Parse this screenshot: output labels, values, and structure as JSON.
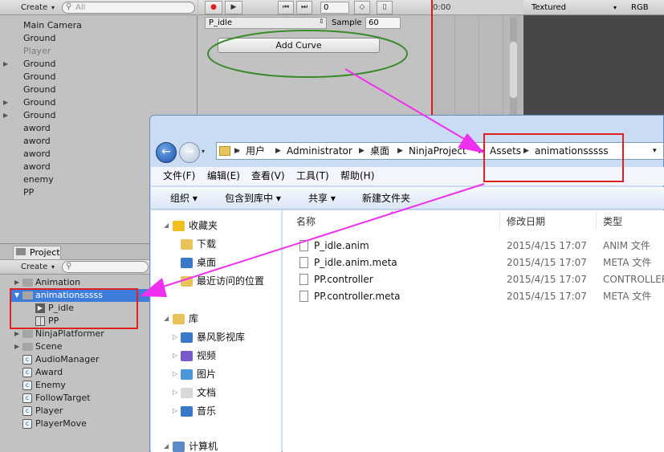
{
  "hierarchy": {
    "create_label": "Create",
    "search_placeholder": "All",
    "items": [
      {
        "label": "Main Camera",
        "expand": false,
        "gray": false
      },
      {
        "label": "Ground",
        "expand": false,
        "gray": false
      },
      {
        "label": "Player",
        "expand": false,
        "gray": true
      },
      {
        "label": "Ground",
        "expand": true,
        "gray": false
      },
      {
        "label": "Ground",
        "expand": false,
        "gray": false
      },
      {
        "label": "Ground",
        "expand": false,
        "gray": false
      },
      {
        "label": "Ground",
        "expand": true,
        "gray": false
      },
      {
        "label": "Ground",
        "expand": true,
        "gray": false
      },
      {
        "label": "aword",
        "expand": false,
        "gray": false
      },
      {
        "label": "aword",
        "expand": false,
        "gray": false
      },
      {
        "label": "aword",
        "expand": false,
        "gray": false
      },
      {
        "label": "aword",
        "expand": false,
        "gray": false
      },
      {
        "label": "enemy",
        "expand": false,
        "gray": false
      },
      {
        "label": "PP",
        "expand": false,
        "gray": false
      }
    ]
  },
  "animation": {
    "frame_value": "0",
    "clip_name": "P_idle",
    "sample_label": "Sample",
    "sample_value": "60",
    "add_curve_label": "Add Curve",
    "time_label": "0:00"
  },
  "game": {
    "shading": "Textured",
    "channel": "RGB"
  },
  "project": {
    "tab_label": "Project",
    "create_label": "Create",
    "items": [
      {
        "label": "Animation",
        "icon": "folder",
        "expand": "closed",
        "indent": 0
      },
      {
        "label": "animationsssss",
        "icon": "folder",
        "expand": "open",
        "indent": 0,
        "selected": true
      },
      {
        "label": "P_idle",
        "icon": "anim",
        "expand": "none",
        "indent": 1
      },
      {
        "label": "PP",
        "icon": "controller",
        "expand": "none",
        "indent": 1
      },
      {
        "label": "NinjaPlatformer",
        "icon": "folder",
        "expand": "closed",
        "indent": 0
      },
      {
        "label": "Scene",
        "icon": "folder",
        "expand": "closed",
        "indent": 0
      },
      {
        "label": "AudioManager",
        "icon": "script",
        "expand": "none",
        "indent": 0
      },
      {
        "label": "Award",
        "icon": "script",
        "expand": "none",
        "indent": 0
      },
      {
        "label": "Enemy",
        "icon": "script",
        "expand": "none",
        "indent": 0
      },
      {
        "label": "FollowTarget",
        "icon": "script",
        "expand": "none",
        "indent": 0
      },
      {
        "label": "Player",
        "icon": "script",
        "expand": "none",
        "indent": 0
      },
      {
        "label": "PlayerMove",
        "icon": "script",
        "expand": "none",
        "indent": 0
      }
    ]
  },
  "explorer": {
    "breadcrumb": [
      "用户",
      "Administrator",
      "桌面",
      "NinjaProject",
      "Assets",
      "animationsssss"
    ],
    "breadcrumb_prefix": "«",
    "menu": [
      "文件(F)",
      "编辑(E)",
      "查看(V)",
      "工具(T)",
      "帮助(H)"
    ],
    "commands": [
      "组织 ▾",
      "包含到库中 ▾",
      "共享 ▾",
      "新建文件夹"
    ],
    "nav": [
      {
        "label": "收藏夹",
        "icon": "star-icon",
        "level": 0
      },
      {
        "label": "下载",
        "icon": "download-folder-icon",
        "level": 1
      },
      {
        "label": "桌面",
        "icon": "desktop-icon",
        "level": 1
      },
      {
        "label": "最近访问的位置",
        "icon": "recent-places-icon",
        "level": 1
      },
      {
        "label": "库",
        "icon": "library-icon",
        "level": 0
      },
      {
        "label": "暴风影视库",
        "icon": "video-library-icon",
        "level": 1
      },
      {
        "label": "视频",
        "icon": "video-icon",
        "level": 1
      },
      {
        "label": "图片",
        "icon": "picture-icon",
        "level": 1
      },
      {
        "label": "文档",
        "icon": "document-icon",
        "level": 1
      },
      {
        "label": "音乐",
        "icon": "music-icon",
        "level": 1
      },
      {
        "label": "计算机",
        "icon": "computer-icon",
        "level": 0
      }
    ],
    "columns": {
      "name": "名称",
      "date": "修改日期",
      "type": "类型"
    },
    "files": [
      {
        "name": "P_idle.anim",
        "date": "2015/4/15 17:07",
        "type": "ANIM 文件"
      },
      {
        "name": "P_idle.anim.meta",
        "date": "2015/4/15 17:07",
        "type": "META 文件"
      },
      {
        "name": "PP.controller",
        "date": "2015/4/15 17:07",
        "type": "CONTROLLER"
      },
      {
        "name": "PP.controller.meta",
        "date": "2015/4/15 17:07",
        "type": "META 文件"
      }
    ]
  },
  "colors": {
    "arrow": "#f030f0",
    "highlight_box": "#e02020",
    "ellipse": "#3a8a2a",
    "selection": "#3e7ddc"
  }
}
